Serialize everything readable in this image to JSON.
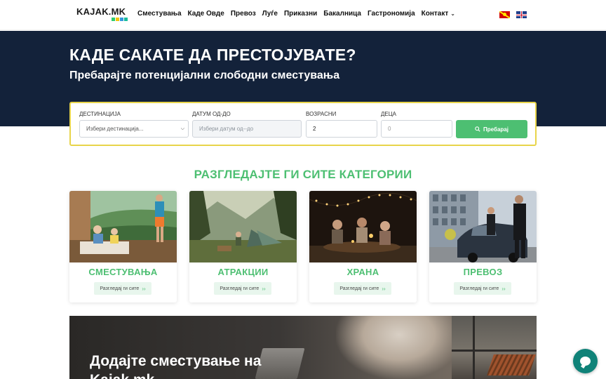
{
  "header": {
    "logo_text": "KAJAK.MK",
    "logo_colors": [
      "#2ecc71",
      "#f1c40f",
      "#3498db",
      "#1abc9c"
    ],
    "nav": [
      {
        "label": "Сместувања"
      },
      {
        "label": "Каде Овде"
      },
      {
        "label": "Превоз"
      },
      {
        "label": "Луѓе"
      },
      {
        "label": "Приказни"
      },
      {
        "label": "Бакалница"
      },
      {
        "label": "Гастрономија"
      },
      {
        "label": "Контакт",
        "has_dropdown": true
      }
    ],
    "languages": [
      "mk-flag-icon",
      "uk-flag-icon"
    ]
  },
  "hero": {
    "title": "КАДЕ САКАТЕ ДА ПРЕСТОЈУВАТЕ?",
    "subtitle": "Пребарајте потенцијални слободни сместувања",
    "background_color": "#13223a"
  },
  "search": {
    "destination": {
      "label": "ДЕСТИНАЦИЈА",
      "value": "Избери дестинација..."
    },
    "dates": {
      "label": "ДАТУМ ОД-ДО",
      "placeholder": "Избери датум од--до"
    },
    "adults": {
      "label": "ВОЗРАСНИ",
      "value": "2"
    },
    "kids": {
      "label": "ДЕЦА",
      "value": "0"
    },
    "submit_label": "Пребарај",
    "accent": "#4dbf72",
    "border_color": "#e8d44a"
  },
  "categories": {
    "title": "РАЗГЛЕДАЈТЕ ГИ СИТЕ КАТЕГОРИИ",
    "items": [
      {
        "title": "СМЕСТУВАЊА",
        "button": "Разгледај ги сите"
      },
      {
        "title": "АТРАКЦИИ",
        "button": "Разгледај ги сите"
      },
      {
        "title": "ХРАНА",
        "button": "Разгледај ги сите"
      },
      {
        "title": "ПРЕВОЗ",
        "button": "Разгледај ги сите"
      }
    ]
  },
  "banner": {
    "title": "Додајте сместување на Kajak.mk"
  }
}
